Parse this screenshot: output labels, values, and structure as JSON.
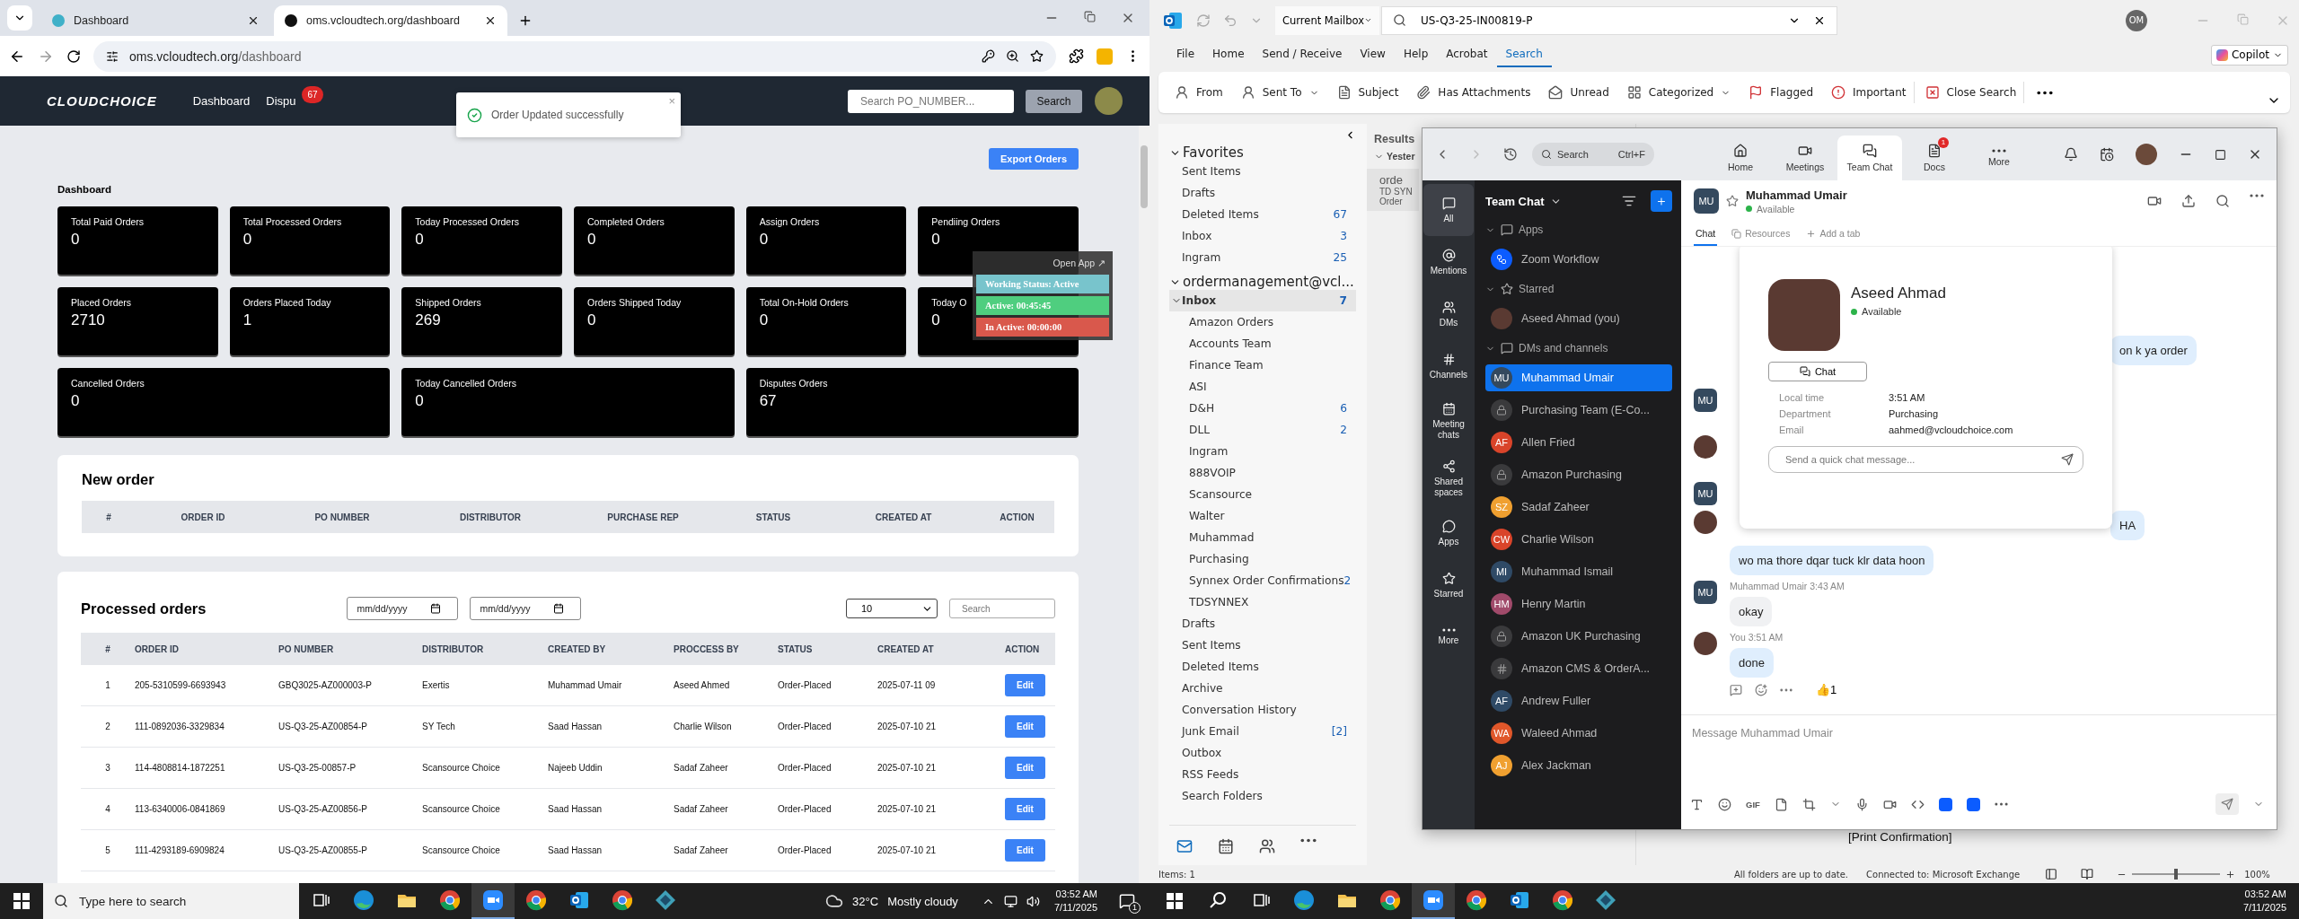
{
  "left_screen": {
    "browser": {
      "tabs": [
        {
          "title": "Dashboard",
          "selected": false
        },
        {
          "title": "oms.vcloudtech.org/dashboard",
          "selected": true
        }
      ],
      "url": {
        "host": "oms.vcloudtech.org",
        "path": "/dashboard"
      }
    },
    "navbar": {
      "logo": "CLOUDCHOICE",
      "links": [
        {
          "label": "Dashboard"
        },
        {
          "label": "Dispu",
          "badge": "67"
        }
      ],
      "search": {
        "placeholder": "Search PO_NUMBER...",
        "button": "Search"
      }
    },
    "toast": {
      "message": "Order Updated successfully",
      "close": "×"
    },
    "export_button": "Export Orders",
    "heading": "Dashboard",
    "stats": [
      {
        "label": "Total Paid Orders",
        "value": "0",
        "wide": false
      },
      {
        "label": "Total Processed Orders",
        "value": "0",
        "wide": false
      },
      {
        "label": "Today Processed Orders",
        "value": "0",
        "wide": false
      },
      {
        "label": "Completed Orders",
        "value": "0",
        "wide": false
      },
      {
        "label": "Assign Orders",
        "value": "0",
        "wide": false
      },
      {
        "label": "Pendiing Orders",
        "value": "0",
        "wide": false
      },
      {
        "label": "Placed Orders",
        "value": "2710",
        "wide": false
      },
      {
        "label": "Orders Placed Today",
        "value": "1",
        "wide": false
      },
      {
        "label": "Shipped Orders",
        "value": "269",
        "wide": false
      },
      {
        "label": "Orders Shipped Today",
        "value": "0",
        "wide": false
      },
      {
        "label": "Total On-Hold Orders",
        "value": "0",
        "wide": false
      },
      {
        "label": "Today O",
        "value": "0",
        "wide": false
      },
      {
        "label": "Cancelled Orders",
        "value": "0",
        "wide": true
      },
      {
        "label": "Today Cancelled Orders",
        "value": "0",
        "wide": true
      },
      {
        "label": "Disputes Orders",
        "value": "67",
        "wide": true
      }
    ],
    "timer_widget": {
      "open_app": "Open App ↗",
      "rows": [
        {
          "text": "Working Status: Active",
          "kind": "status"
        },
        {
          "text": "Active: 00:45:45",
          "kind": "active"
        },
        {
          "text": "In Active: 00:00:00",
          "kind": "inactive"
        }
      ]
    },
    "new_order": {
      "title": "New order",
      "columns": [
        "#",
        "ORDER ID",
        "PO NUMBER",
        "DISTRIBUTOR",
        "PURCHASE REP",
        "STATUS",
        "CREATED AT",
        "ACTION"
      ]
    },
    "processed_orders": {
      "title": "Processed orders",
      "date_from": {
        "placeholder": "mm/dd/yyyy"
      },
      "date_to": {
        "placeholder": "mm/dd/yyyy"
      },
      "page_size": "10",
      "search": {
        "placeholder": "Search"
      },
      "columns": [
        "#",
        "ORDER ID",
        "PO NUMBER",
        "DISTRIBUTOR",
        "CREATED BY",
        "PROCCESS BY",
        "STATUS",
        "CREATED AT",
        "ACTION"
      ],
      "rows": [
        {
          "cells": [
            "1",
            "205-5310599-6693943",
            "GBQ3025-AZ000003-P",
            "Exertis",
            "Muhammad Umair",
            "Aseed Ahmed",
            "Order-Placed",
            "2025-07-11 09"
          ],
          "action": "Edit"
        },
        {
          "cells": [
            "2",
            "111-0892036-3329834",
            "US-Q3-25-AZ00854-P",
            "SY Tech",
            "Saad Hassan",
            "Charlie Wilson",
            "Order-Placed",
            "2025-07-10 21"
          ],
          "action": "Edit"
        },
        {
          "cells": [
            "3",
            "114-4808814-1872251",
            "US-Q3-25-00857-P",
            "Scansource Choice",
            "Najeeb Uddin",
            "Sadaf Zaheer",
            "Order-Placed",
            "2025-07-10 21"
          ],
          "action": "Edit"
        },
        {
          "cells": [
            "4",
            "113-6340006-0841869",
            "US-Q3-25-AZ00856-P",
            "Scansource Choice",
            "Saad Hassan",
            "Sadaf Zaheer",
            "Order-Placed",
            "2025-07-10 21"
          ],
          "action": "Edit"
        },
        {
          "cells": [
            "5",
            "111-4293189-6909824",
            "US-Q3-25-AZ00855-P",
            "Scansource Choice",
            "Saad Hassan",
            "Sadaf Zaheer",
            "Order-Placed",
            "2025-07-10 21"
          ],
          "action": "Edit"
        }
      ]
    },
    "taskbar": {
      "search_placeholder": "Type here to search",
      "apps": [
        {
          "kind": "taskview",
          "selected": false
        },
        {
          "kind": "edge",
          "selected": false
        },
        {
          "kind": "explorer",
          "selected": false
        },
        {
          "kind": "chrome",
          "selected": false
        },
        {
          "kind": "zoom",
          "selected": true
        },
        {
          "kind": "chrome",
          "selected": false
        },
        {
          "kind": "outlook",
          "selected": false
        },
        {
          "kind": "chrome",
          "selected": false
        },
        {
          "kind": "app",
          "selected": false
        }
      ],
      "weather": {
        "temp": "32°C",
        "condition": "Mostly cloudy"
      },
      "time": "03:52 AM",
      "date": "7/11/2025",
      "notifications": "1"
    }
  },
  "right_screen": {
    "outlook": {
      "scope": "Current Mailbox",
      "search_value": "US-Q3-25-IN00819-P",
      "account_initials": "OM",
      "copilot": "Copilot",
      "menu": [
        {
          "label": "File",
          "selected": false
        },
        {
          "label": "Home",
          "selected": false
        },
        {
          "label": "Send / Receive",
          "selected": false
        },
        {
          "label": "View",
          "selected": false
        },
        {
          "label": "Help",
          "selected": false
        },
        {
          "label": "Acrobat",
          "selected": false
        },
        {
          "label": "Search",
          "selected": true
        }
      ],
      "ribbon": [
        {
          "label": "From",
          "dropdown": false
        },
        {
          "label": "Sent To",
          "dropdown": true
        },
        {
          "label": "Subject",
          "dropdown": false
        },
        {
          "label": "Has Attachments",
          "dropdown": false
        },
        {
          "label": "Unread",
          "dropdown": false
        },
        {
          "label": "Categorized",
          "dropdown": true
        },
        {
          "label": "Flagged",
          "dropdown": false
        },
        {
          "label": "Important",
          "dropdown": false
        },
        {
          "label": "Close Search",
          "dropdown": false
        }
      ],
      "favorites": {
        "title": "Favorites",
        "items": [
          {
            "name": "Sent Items"
          },
          {
            "name": "Drafts"
          },
          {
            "name": "Deleted Items",
            "count": "67"
          },
          {
            "name": "Inbox",
            "count": "3"
          },
          {
            "name": "Ingram",
            "count": "25"
          }
        ]
      },
      "account": {
        "title": "ordermanagement@vcl...",
        "inbox": {
          "name": "Inbox",
          "count": "7",
          "subfolders": [
            {
              "name": "Amazon Orders"
            },
            {
              "name": "Accounts Team"
            },
            {
              "name": "Finance Team"
            },
            {
              "name": "ASI"
            },
            {
              "name": "D&H",
              "count": "6"
            },
            {
              "name": "DLL",
              "count": "2"
            },
            {
              "name": "Ingram"
            },
            {
              "name": "888VOIP"
            },
            {
              "name": "Scansource"
            },
            {
              "name": "Walter"
            },
            {
              "name": "Muhammad"
            },
            {
              "name": "Purchasing"
            },
            {
              "name": "Synnex Order Confirmations",
              "count": "2"
            },
            {
              "name": "TDSYNNEX"
            }
          ]
        },
        "folders": [
          {
            "name": "Drafts"
          },
          {
            "name": "Sent Items"
          },
          {
            "name": "Deleted Items"
          },
          {
            "name": "Archive"
          },
          {
            "name": "Conversation History"
          },
          {
            "name": "Junk Email",
            "count": "[2]"
          },
          {
            "name": "Outbox"
          },
          {
            "name": "RSS Feeds"
          },
          {
            "name": "Search Folders"
          }
        ]
      },
      "results": {
        "title": "Results",
        "group": "Yester",
        "item": {
          "from": "orde",
          "subject": "TD SYN",
          "preview": "Order"
        }
      },
      "reading_pane_text": "[Print Confirmation]",
      "status_bar": {
        "items": "Items: 1",
        "sync": "All folders are up to date.",
        "connection": "Connected to: Microsoft Exchange",
        "zoom_slider": {
          "level": 0.5
        },
        "zoom": "100%"
      }
    },
    "zoom": {
      "search": "Search",
      "shortcut": "Ctrl+F",
      "tabs": [
        {
          "label": "Home",
          "selected": false
        },
        {
          "label": "Meetings",
          "selected": false
        },
        {
          "label": "Team Chat",
          "selected": true
        },
        {
          "label": "Docs",
          "selected": false,
          "badge": "1"
        },
        {
          "label": "More",
          "selected": false
        }
      ],
      "rail": [
        {
          "label": "All",
          "selected": true
        },
        {
          "label": "Mentions",
          "selected": false
        },
        {
          "label": "DMs",
          "selected": false
        },
        {
          "label": "Channels",
          "selected": false
        },
        {
          "label": "Meeting chats",
          "selected": false
        },
        {
          "label": "Shared spaces",
          "selected": false
        },
        {
          "label": "Apps",
          "selected": false
        },
        {
          "label": "Starred",
          "selected": false
        },
        {
          "label": "More",
          "selected": false
        }
      ],
      "sidebar": {
        "title": "Team Chat",
        "sections": [
          {
            "title": "Apps",
            "items": [
              {
                "name": "Zoom Workflow",
                "kind": "app",
                "selected": false
              }
            ]
          },
          {
            "title": "Starred",
            "items": [
              {
                "name": "Aseed Ahmad (you)",
                "kind": "photo",
                "selected": false
              }
            ]
          },
          {
            "title": "DMs and channels",
            "items": [
              {
                "name": "Muhammad Umair",
                "kind": "initials",
                "initials": "MU",
                "color": "#34495e",
                "selected": true
              },
              {
                "name": "Purchasing Team (E-Co...",
                "kind": "lock",
                "selected": false
              },
              {
                "name": "Allen Fried",
                "kind": "initials",
                "initials": "AF",
                "color": "#d9442a",
                "selected": false
              },
              {
                "name": "Amazon Purchasing",
                "kind": "lock",
                "selected": false
              },
              {
                "name": "Sadaf Zaheer",
                "kind": "initials",
                "initials": "SZ",
                "color": "#f0a030",
                "selected": false
              },
              {
                "name": "Charlie Wilson",
                "kind": "initials",
                "initials": "CW",
                "color": "#d9442a",
                "selected": false
              },
              {
                "name": "Muhammad Ismail",
                "kind": "initials",
                "initials": "MI",
                "color": "#2f4a66",
                "selected": false
              },
              {
                "name": "Henry Martin",
                "kind": "initials",
                "initials": "HM",
                "color": "#a04a6a",
                "selected": false
              },
              {
                "name": "Amazon UK Purchasing",
                "kind": "lock",
                "selected": false
              },
              {
                "name": "Amazon CMS & OrderA...",
                "kind": "hash",
                "selected": false
              },
              {
                "name": "Andrew Fuller",
                "kind": "initials",
                "initials": "AF",
                "color": "#2f4a66",
                "selected": false
              },
              {
                "name": "Waleed Ahmad",
                "kind": "initials",
                "initials": "WA",
                "color": "#e0572a",
                "selected": false
              },
              {
                "name": "Alex Jackman",
                "kind": "initials",
                "initials": "AJ",
                "color": "#f0a030",
                "selected": false
              }
            ]
          }
        ]
      },
      "chat": {
        "initials": "MU",
        "name": "Muhammad Umair",
        "status": "Available",
        "tabs": [
          {
            "label": "Chat",
            "selected": true
          },
          {
            "label": "Resources",
            "selected": false
          },
          {
            "label": "Add a tab",
            "selected": false
          }
        ],
        "messages": [
          {
            "kind": "none",
            "partial": true,
            "text": "on k ya order"
          },
          {
            "kind": "initials",
            "initials": "MU"
          },
          {
            "kind": "photo"
          },
          {
            "kind": "initials",
            "initials": "MU"
          },
          {
            "kind": "photo",
            "partial": true,
            "text": "HA"
          },
          {
            "kind": "none",
            "partial": false,
            "text": "wo ma thore dqar tuck klr data hoon"
          },
          {
            "kind": "initials",
            "initials": "MU",
            "sender": "Muhammad Umair",
            "time": "3:43 AM",
            "text": "okay"
          },
          {
            "kind": "photo",
            "sender": "You",
            "time": "3:51 AM",
            "text": "done",
            "reaction": {
              "emoji": "👍",
              "count": "1"
            }
          }
        ],
        "composer": {
          "placeholder": "Message Muhammad Umair",
          "gif": "GIF"
        }
      },
      "profile_card": {
        "name": "Aseed Ahmad",
        "status": "Available",
        "button": "Chat",
        "details": [
          {
            "label": "Local time",
            "value": "3:51 AM"
          },
          {
            "label": "Department",
            "value": "Purchasing"
          },
          {
            "label": "Email",
            "value": "aahmed@vcloudchoice.com"
          }
        ],
        "quick_message": {
          "placeholder": "Send a quick chat message..."
        }
      }
    },
    "taskbar": {
      "apps": [
        {
          "kind": "search",
          "selected": false
        },
        {
          "kind": "taskview",
          "selected": false
        },
        {
          "kind": "edge",
          "selected": false
        },
        {
          "kind": "explorer",
          "selected": false
        },
        {
          "kind": "chrome",
          "selected": false
        },
        {
          "kind": "zoom",
          "selected": true
        },
        {
          "kind": "chrome",
          "selected": false
        },
        {
          "kind": "outlook",
          "selected": false
        },
        {
          "kind": "chrome",
          "selected": false
        },
        {
          "kind": "app",
          "selected": false
        }
      ],
      "time": "03:52 AM",
      "date": "7/11/2025"
    }
  }
}
